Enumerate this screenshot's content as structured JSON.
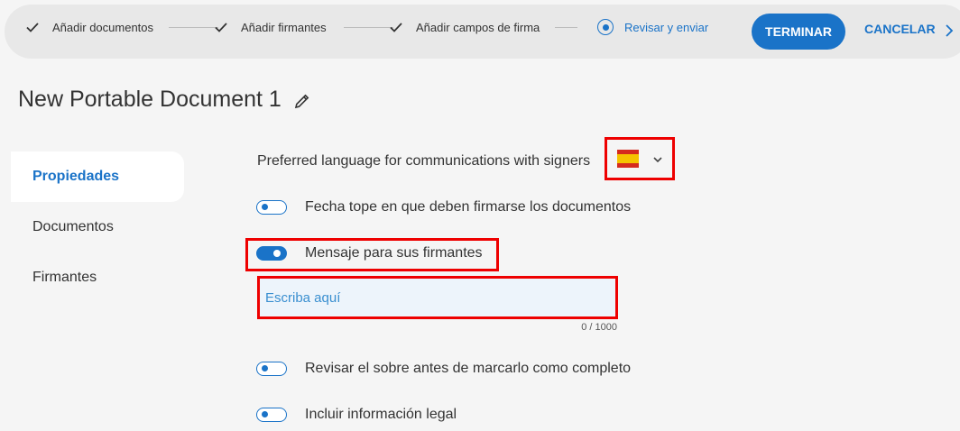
{
  "stepper": {
    "steps": [
      {
        "label": "Añadir documentos",
        "state": "done"
      },
      {
        "label": "Añadir firmantes",
        "state": "done"
      },
      {
        "label": "Añadir campos de firma",
        "state": "done"
      },
      {
        "label": "Revisar y enviar",
        "state": "active"
      }
    ],
    "finish_label": "TERMINAR",
    "cancel_label": "CANCELAR"
  },
  "document": {
    "title": "New Portable Document 1"
  },
  "sidebar": {
    "items": [
      {
        "label": "Propiedades",
        "active": true
      },
      {
        "label": "Documentos",
        "active": false
      },
      {
        "label": "Firmantes",
        "active": false
      }
    ]
  },
  "properties": {
    "language_label": "Preferred language for communications with signers",
    "language_flag": "spain-flag-icon",
    "deadline_label": "Fecha tope en que deben firmarse los documentos",
    "deadline_on": false,
    "message_label": "Mensaje para sus firmantes",
    "message_on": true,
    "message_placeholder": "Escriba aquí",
    "message_value": "",
    "message_counter": "0 / 1000",
    "review_label": "Revisar el sobre antes de marcarlo como completo",
    "review_on": false,
    "legal_label": "Incluir información legal",
    "legal_on": false
  },
  "colors": {
    "accent": "#1a73c8",
    "highlight": "#e00000",
    "background": "#f5f5f5",
    "stepbar": "#e8e8e8"
  }
}
